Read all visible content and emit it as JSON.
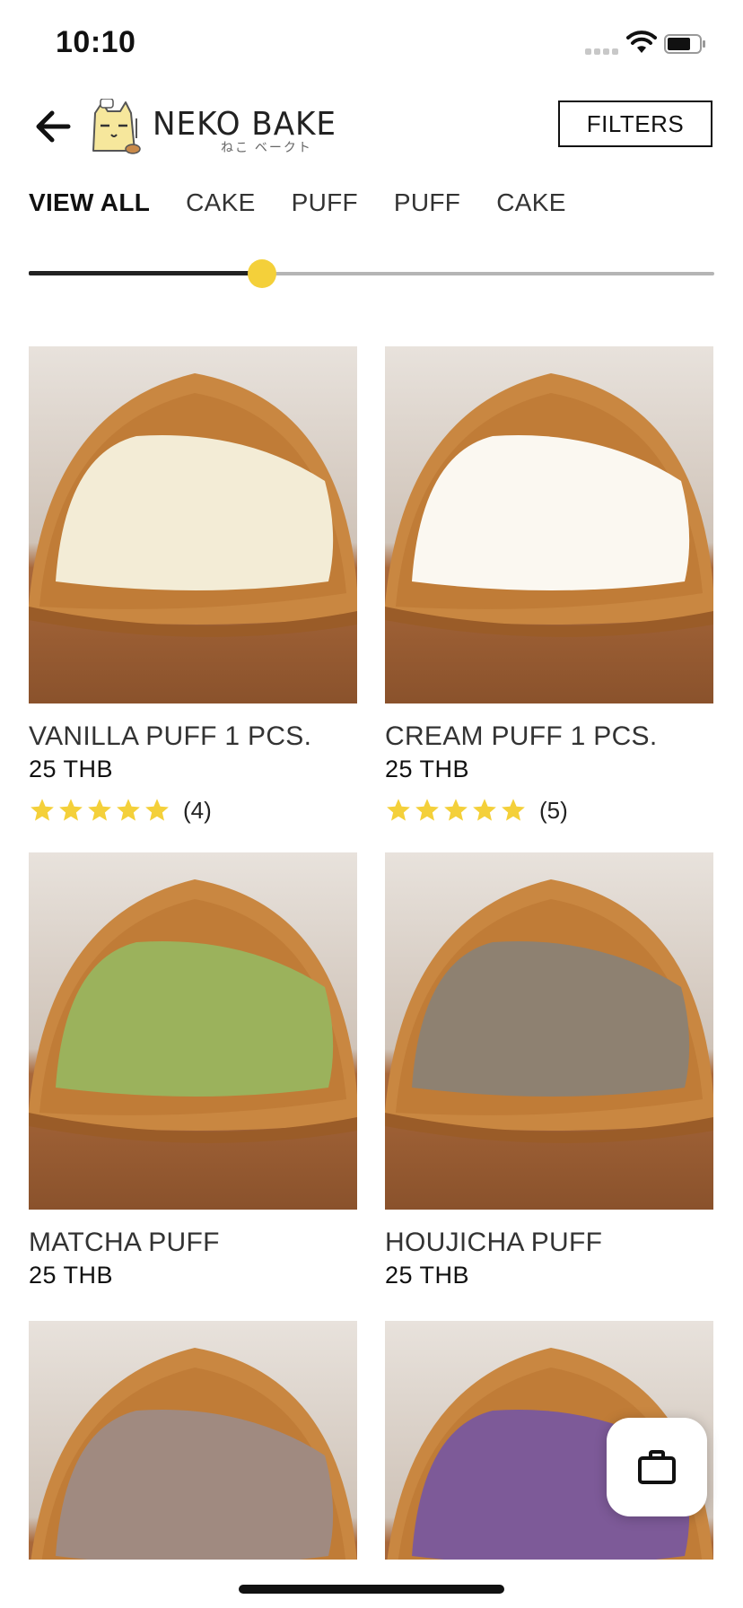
{
  "status_bar": {
    "time": "10:10"
  },
  "header": {
    "brand": "NEKO BAKE",
    "brand_sub": "ねこ ベークト",
    "filters_label": "FILTERS"
  },
  "tabs": [
    "VIEW ALL",
    "CAKE",
    "PUFF",
    "PUFF",
    "CAKE"
  ],
  "active_tab": 0,
  "slider": {
    "value_fraction": 0.34
  },
  "colors": {
    "accent": "#f4d03a",
    "text": "#111111"
  },
  "products": [
    {
      "name": "VANILLA PUFF 1 PCS.",
      "price": "25 THB",
      "rating": 5,
      "review_count": "(4)",
      "filling": "#f3ecd6"
    },
    {
      "name": "CREAM PUFF 1 PCS.",
      "price": "25 THB",
      "rating": 5,
      "review_count": "(5)",
      "filling": "#fbf8f1"
    },
    {
      "name": "MATCHA PUFF",
      "price": "25 THB",
      "filling": "#9bb25c"
    },
    {
      "name": "HOUJICHA PUFF",
      "price": "25 THB",
      "filling": "#8e8171"
    },
    {
      "filling": "#a08a80"
    },
    {
      "filling": "#7d5a98"
    }
  ],
  "icons": {
    "back": "arrow-left-icon",
    "cart": "briefcase-icon",
    "star": "star-icon"
  }
}
